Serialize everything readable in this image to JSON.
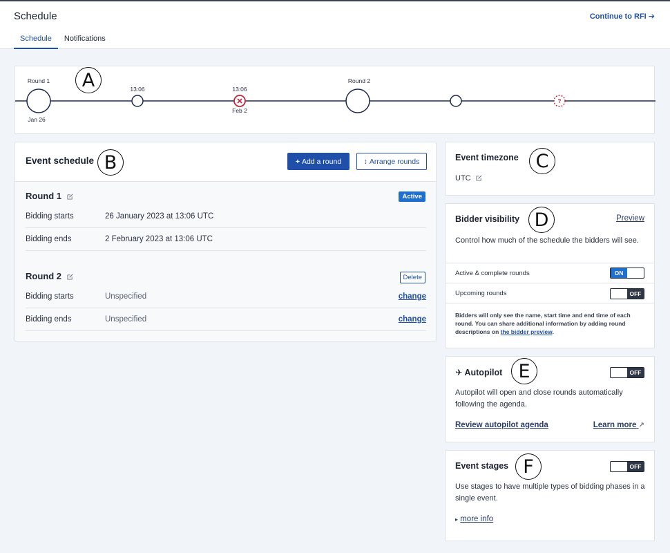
{
  "header": {
    "title": "Schedule",
    "continue_link": "Continue to RFI",
    "tabs": [
      {
        "label": "Schedule",
        "active": true
      },
      {
        "label": "Notifications",
        "active": false
      }
    ]
  },
  "timeline": {
    "round1_label": "Round 1",
    "round1_date": "Jan 26",
    "point1_time": "13:06",
    "point2_time": "13:06",
    "point2_date": "Feb 2",
    "round2_label": "Round 2"
  },
  "callouts": [
    "A",
    "B",
    "C",
    "D",
    "E",
    "F"
  ],
  "event_schedule": {
    "title": "Event schedule",
    "add_round": "Add a round",
    "arrange_rounds": "Arrange rounds",
    "rounds": [
      {
        "name": "Round 1",
        "status": "Active",
        "rows": [
          {
            "label": "Bidding starts",
            "value": "26 January 2023 at 13:06 UTC"
          },
          {
            "label": "Bidding ends",
            "value": "2 February 2023 at 13:06 UTC"
          }
        ]
      },
      {
        "name": "Round 2",
        "delete_label": "Delete",
        "rows": [
          {
            "label": "Bidding starts",
            "value": "Unspecified",
            "action": "change"
          },
          {
            "label": "Bidding ends",
            "value": "Unspecified",
            "action": "change"
          }
        ]
      }
    ]
  },
  "event_timezone": {
    "title": "Event timezone",
    "value": "UTC"
  },
  "bidder_visibility": {
    "title": "Bidder visibility",
    "preview": "Preview",
    "description": "Control how much of the schedule the bidders will see.",
    "rows": [
      {
        "label": "Active & complete rounds",
        "state": "ON"
      },
      {
        "label": "Upcoming rounds",
        "state": "OFF"
      }
    ],
    "note": "Bidders will only see the name, start time and end time of each round. You can share additional information by adding round descriptions on",
    "note_link": "the bidder preview",
    "note_end": "."
  },
  "autopilot": {
    "title": "Autopilot",
    "state": "OFF",
    "description": "Autopilot will open and close rounds automatically following the agenda.",
    "review_link": "Review autopilot agenda",
    "learn_more": "Learn more"
  },
  "event_stages": {
    "title": "Event stages",
    "state": "OFF",
    "description": "Use stages to have multiple types of bidding phases in a single event.",
    "more_info": "more info"
  },
  "colors": {
    "primary": "#1f4fa8",
    "active_badge": "#1f6fd1",
    "error": "#c0253a",
    "toggle_off": "#2f3646"
  }
}
